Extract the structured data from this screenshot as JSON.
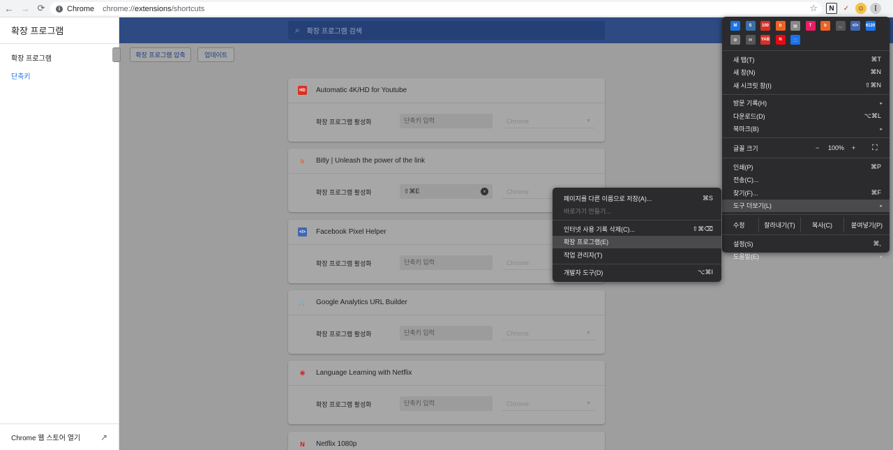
{
  "browser": {
    "site_name": "Chrome",
    "url_prefix": "chrome://",
    "url_host": "extensions",
    "url_path": "/shortcuts",
    "nav": {
      "back": "←",
      "forward": "→",
      "reload": "⟳"
    },
    "star": "☆",
    "toolbar_icons": [
      "N",
      "✓",
      "☺",
      "⋮"
    ]
  },
  "sidebar": {
    "title": "확장 프로그램",
    "items": [
      {
        "label": "확장 프로그램",
        "active": false
      },
      {
        "label": "단축키",
        "active": true
      }
    ],
    "footer_label": "Chrome 웹 스토어 열기",
    "footer_icon": "↗"
  },
  "search": {
    "placeholder": "확장 프로그램 검색",
    "icon": "⌕"
  },
  "toolbar": {
    "buttons": [
      "확장 프로그램 압축",
      "업데이트"
    ]
  },
  "extensions": [
    {
      "name": "Automatic 4K/HD for Youtube",
      "icon": "HD",
      "icon_color": "#d93025",
      "label": "확장 프로그램 활성화",
      "shortcut": "",
      "placeholder": "단축키 입력",
      "scope": "Chrome"
    },
    {
      "name": "Bitly | Unleash the power of the link",
      "icon": "b",
      "icon_color": "#ee6123",
      "label": "확장 프로그램 활성화",
      "shortcut": "⇧⌘E",
      "placeholder": "단축키 입력",
      "scope": "Chrome"
    },
    {
      "name": "Facebook Pixel Helper",
      "icon": "</>",
      "icon_color": "#4267b2",
      "label": "확장 프로그램 활성화",
      "shortcut": "",
      "placeholder": "단축키 입력",
      "scope": "Chrome"
    },
    {
      "name": "Google Analytics URL Builder",
      "icon": "🛒",
      "icon_color": "#c62828",
      "label": "확장 프로그램 활성화",
      "shortcut": "",
      "placeholder": "단축키 입력",
      "scope": "Chrome"
    },
    {
      "name": "Language Learning with Netflix",
      "icon": "◉",
      "icon_color": "#c62828",
      "label": "확장 프로그램 활성화",
      "shortcut": "",
      "placeholder": "단축키 입력",
      "scope": "Chrome"
    },
    {
      "name": "Netflix 1080p",
      "icon": "N",
      "icon_color": "#e50914"
    }
  ],
  "chrome_menu": {
    "ext_icons": [
      {
        "glyph": "M",
        "color": "#1a73e8"
      },
      {
        "glyph": "S",
        "color": "#3b6ea5"
      },
      {
        "glyph": "100",
        "color": "#d93025"
      },
      {
        "glyph": "b",
        "color": "#ee6123"
      },
      {
        "glyph": "▤",
        "color": "#888"
      },
      {
        "glyph": "T",
        "color": "#e91e63"
      },
      {
        "glyph": "b",
        "color": "#ee6123"
      },
      {
        "glyph": "◡",
        "color": "#555"
      },
      {
        "glyph": "</>",
        "color": "#4267b2"
      },
      {
        "glyph": "6120",
        "color": "#1a73e8"
      },
      {
        "glyph": "⊘",
        "color": "#777"
      },
      {
        "glyph": "✉",
        "color": "#555"
      },
      {
        "glyph": "YAB",
        "color": "#d93025"
      },
      {
        "glyph": "N",
        "color": "#e50914"
      },
      {
        "glyph": "⬚",
        "color": "#1a73e8"
      }
    ],
    "group1": [
      {
        "label": "새 탭(T)",
        "shortcut": "⌘T"
      },
      {
        "label": "새 창(N)",
        "shortcut": "⌘N"
      },
      {
        "label": "새 시크릿 창(I)",
        "shortcut": "⇧⌘N"
      }
    ],
    "group2": [
      {
        "label": "방문 기록(H)",
        "submenu": "▸"
      },
      {
        "label": "다운로드(D)",
        "shortcut": "⌥⌘L"
      },
      {
        "label": "북마크(B)",
        "submenu": "▸"
      }
    ],
    "zoom": {
      "label": "글꼴 크기",
      "minus": "−",
      "value": "100%",
      "plus": "+",
      "fullscreen": "⛶"
    },
    "group3": [
      {
        "label": "인쇄(P)",
        "shortcut": "⌘P"
      },
      {
        "label": "전송(C)...",
        "shortcut": ""
      },
      {
        "label": "찾기(F)...",
        "shortcut": "⌘F"
      },
      {
        "label": "도구 더보기(L)",
        "submenu": "▸"
      }
    ],
    "edit": {
      "label": "수정",
      "cut": "잘라내기(T)",
      "copy": "복사(C)",
      "paste": "붙여넣기(P)"
    },
    "group4": [
      {
        "label": "설정(S)",
        "shortcut": "⌘,"
      },
      {
        "label": "도움말(E)",
        "submenu": "▸"
      }
    ]
  },
  "more_tools_menu": {
    "group1": [
      {
        "label": "페이지를 다른 이름으로 저장(A)...",
        "shortcut": "⌘S",
        "disabled": false
      },
      {
        "label": "바로가기 만들기...",
        "shortcut": "",
        "disabled": true
      }
    ],
    "group2": [
      {
        "label": "인터넷 사용 기록 삭제(C)...",
        "shortcut": "⇧⌘⌫"
      },
      {
        "label": "확장 프로그램(E)",
        "shortcut": ""
      },
      {
        "label": "작업 관리자(T)",
        "shortcut": ""
      }
    ],
    "group3": [
      {
        "label": "개발자 도구(D)",
        "shortcut": "⌥⌘I"
      }
    ]
  }
}
